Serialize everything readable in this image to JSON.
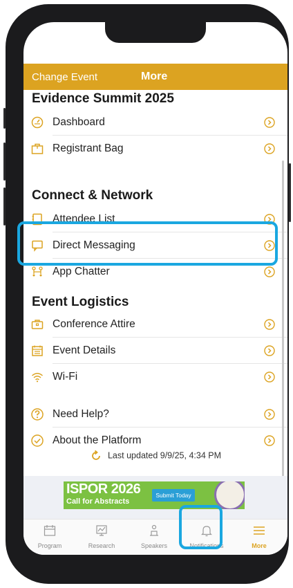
{
  "header": {
    "change_event": "Change Event",
    "title": "More"
  },
  "sections": {
    "event": {
      "title": "Evidence Summit 2025",
      "items": [
        {
          "label": "Dashboard",
          "icon": "dashboard-icon"
        },
        {
          "label": "Registrant Bag",
          "icon": "bag-icon"
        }
      ]
    },
    "connect": {
      "title": "Connect & Network",
      "items": [
        {
          "label": "Attendee List",
          "icon": "attendee-list-icon"
        },
        {
          "label": "Direct Messaging",
          "icon": "messaging-icon"
        },
        {
          "label": "App Chatter",
          "icon": "app-chatter-icon"
        }
      ]
    },
    "logistics": {
      "title": "Event Logistics",
      "items": [
        {
          "label": "Conference Attire",
          "icon": "attire-icon"
        },
        {
          "label": "Event Details",
          "icon": "event-details-icon"
        },
        {
          "label": "Wi-Fi",
          "icon": "wifi-icon"
        }
      ]
    },
    "help": {
      "items": [
        {
          "label": "Need Help?",
          "icon": "help-icon"
        },
        {
          "label": "About the Platform",
          "icon": "check-circle-icon"
        }
      ]
    }
  },
  "last_updated": "Last updated 9/9/25, 4:34 PM",
  "banner": {
    "title": "ISPOR 2026",
    "subtitle": "Call for Abstracts",
    "button": "Submit Today"
  },
  "tabs": [
    {
      "label": "Program",
      "icon": "calendar-icon"
    },
    {
      "label": "Research",
      "icon": "research-icon"
    },
    {
      "label": "Speakers",
      "icon": "speaker-icon"
    },
    {
      "label": "Notifications",
      "icon": "bell-icon"
    },
    {
      "label": "More",
      "icon": "menu-icon"
    }
  ],
  "colors": {
    "accent": "#dca321",
    "highlight": "#1aa7e0"
  }
}
